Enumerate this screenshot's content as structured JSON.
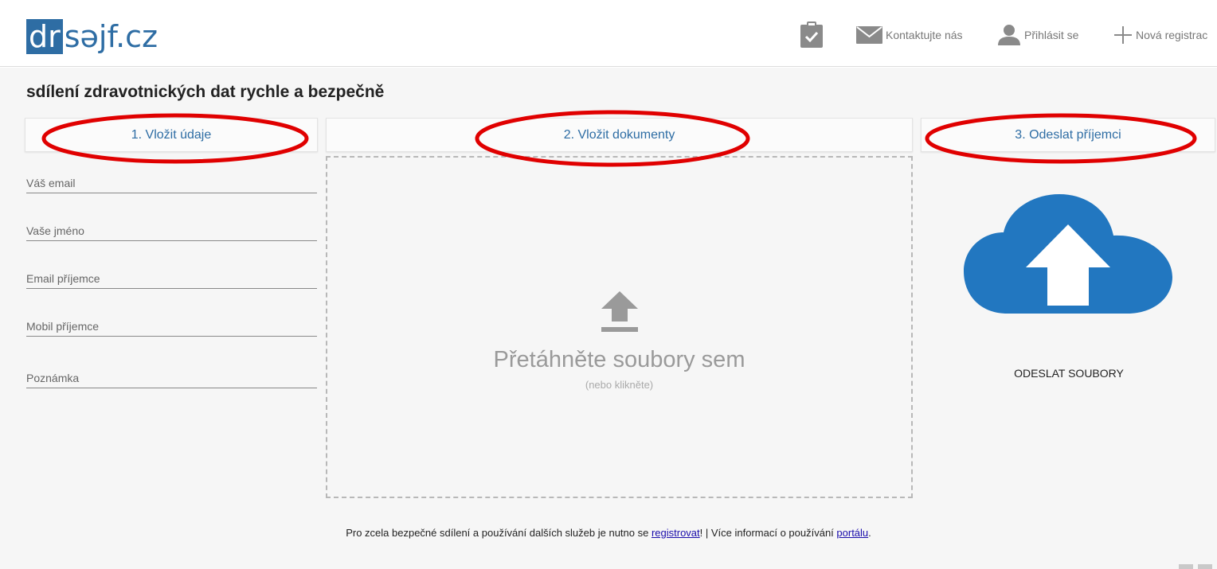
{
  "header": {
    "logo": {
      "box_text": "dr",
      "rest_text": "səjf.cz"
    },
    "nav": {
      "checklist_icon": "clipboard-check-icon",
      "contact_label": "Kontaktujte nás",
      "login_label": "Přihlásit se",
      "register_label": "Nová registrac"
    }
  },
  "main": {
    "title": "sdílení zdravotnických dat rychle a bezpečně",
    "steps": [
      {
        "label": "1. Vložit údaje"
      },
      {
        "label": "2. Vložit dokumenty"
      },
      {
        "label": "3. Odeslat příjemci"
      }
    ],
    "form": {
      "fields": [
        {
          "placeholder": "Váš email"
        },
        {
          "placeholder": "Vaše jméno"
        },
        {
          "placeholder": "Email příjemce"
        },
        {
          "placeholder": "Mobil příjemce"
        },
        {
          "placeholder": "Poznámka"
        }
      ]
    },
    "dropzone": {
      "main_text": "Přetáhněte soubory sem",
      "sub_text": "(nebo klikněte)",
      "icon": "upload-arrow-icon"
    },
    "send": {
      "icon": "cloud-upload-icon",
      "label": "ODESLAT SOUBORY"
    }
  },
  "footer": {
    "text_before": "Pro zcela bezpečné sdílení a používání dalších služeb je nutno se ",
    "link_register": "registrovat",
    "text_middle": "! | Více informací o používání ",
    "link_portal": "portálu",
    "text_after": "."
  },
  "colors": {
    "brand": "#2e6da4",
    "annotation": "#e00000",
    "cloud": "#2277c0",
    "link": "#1a0dab"
  }
}
